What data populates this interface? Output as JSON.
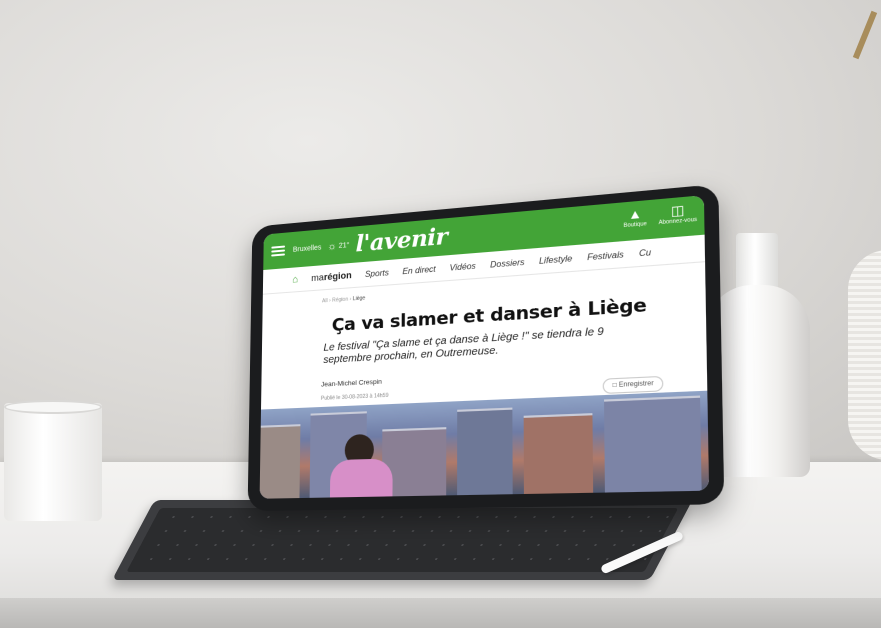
{
  "topbar": {
    "city": "Bruxelles",
    "temperature": "21°",
    "logo": "l'avenir",
    "actions": [
      {
        "label": "Boutique",
        "icon": "bag-icon"
      },
      {
        "label": "Abonnez-vous",
        "icon": "newspaper-icon"
      }
    ],
    "color": "#43a437"
  },
  "nav": {
    "brand_prefix": "ma",
    "brand_main": "région",
    "items": [
      "Sports",
      "En direct",
      "Vidéos",
      "Dossiers",
      "Lifestyle",
      "Festivals",
      "Cu"
    ]
  },
  "article": {
    "breadcrumb": [
      "All",
      "Région",
      "Liège"
    ],
    "title": "Ça va slamer et danser à Liège",
    "lede": "Le festival \"Ça slame et ça danse à Liège !\" se tiendra le 9 septembre prochain, en Outremeuse.",
    "author": "Jean-Michel Crespin",
    "published": "Publié le 30-08-2023 à 14h59",
    "save_label": "Enregistrer"
  }
}
